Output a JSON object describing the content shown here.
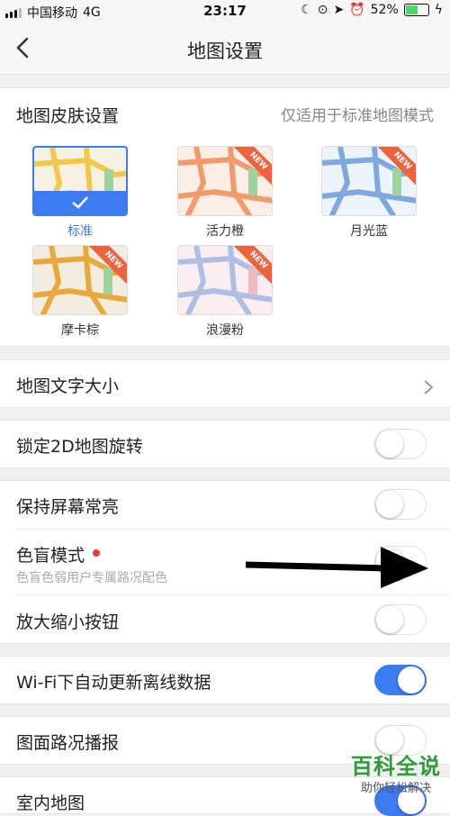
{
  "status_bar": {
    "carrier": "中国移动",
    "network": "4G",
    "time": "23:17",
    "battery": "52%"
  },
  "nav": {
    "title": "地图设置"
  },
  "skin_section": {
    "title": "地图皮肤设置",
    "note": "仅适用于标准地图模式",
    "skins": [
      {
        "name": "标准",
        "selected": true,
        "new": false,
        "color": "#f2c84b"
      },
      {
        "name": "活力橙",
        "selected": false,
        "new": true,
        "color": "#f39a6b"
      },
      {
        "name": "月光蓝",
        "selected": false,
        "new": true,
        "color": "#7ea8de"
      },
      {
        "name": "摩卡棕",
        "selected": false,
        "new": true,
        "color": "#e8a93a"
      },
      {
        "name": "浪漫粉",
        "selected": false,
        "new": true,
        "color": "#aebfe3"
      }
    ],
    "new_badge": "NEW"
  },
  "text_size": {
    "label": "地图文字大小"
  },
  "lock_rotation": {
    "label": "锁定2D地图旋转",
    "on": false
  },
  "keep_screen": {
    "label": "保持屏幕常亮",
    "on": false
  },
  "color_blind": {
    "label": "色盲模式",
    "sub": "色盲色弱用户专属路况配色",
    "on": false
  },
  "zoom_buttons": {
    "label": "放大缩小按钮",
    "on": false
  },
  "wifi_update": {
    "label": "Wi-Fi下自动更新离线数据",
    "on": true
  },
  "traffic_broadcast": {
    "label": "图面路况播报",
    "on": false
  },
  "indoor_map": {
    "label": "室内地图",
    "on": true
  },
  "watermark": {
    "big": "百科全说",
    "small": "助你轻松解决"
  },
  "colors": {
    "accent": "#3b7cf2",
    "badge": "#f0623a",
    "red_dot": "#e63b3b"
  }
}
